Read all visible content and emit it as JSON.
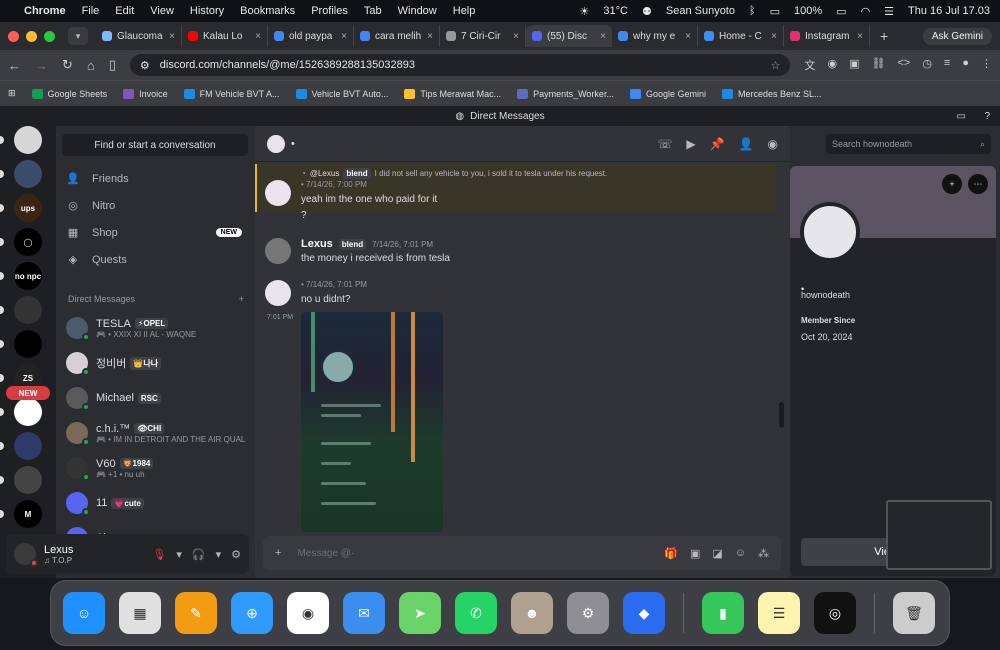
{
  "menubar": {
    "app": "Chrome",
    "items": [
      "File",
      "Edit",
      "View",
      "History",
      "Bookmarks",
      "Profiles",
      "Tab",
      "Window",
      "Help"
    ],
    "weather": "31°C",
    "user": "Sean Sunyoto",
    "battery": "100%",
    "datetime": "Thu 16 Jul  17.03"
  },
  "tabs": [
    {
      "title": "Glaucoma",
      "color": "#7cb9ff"
    },
    {
      "title": "Kalau Lo",
      "color": "#ff0000"
    },
    {
      "title": "old paypa",
      "color": "#4285f4"
    },
    {
      "title": "cara melih",
      "color": "#4285f4"
    },
    {
      "title": "7 Ciri-Cir",
      "color": "#999999"
    },
    {
      "title": "(55) Disc",
      "color": "#5865f2"
    },
    {
      "title": "why my e",
      "color": "#4285f4"
    },
    {
      "title": "Home - C",
      "color": "#3e8ef7"
    },
    {
      "title": "Instagram",
      "color": "#e1306c"
    }
  ],
  "ask_gemini": "Ask Gemini",
  "url": "discord.com/channels/@me/1526389288135032893",
  "bookmarks": [
    {
      "label": "Google Sheets",
      "color": "#0f9d58"
    },
    {
      "label": "Invoice",
      "color": "#7e57c2"
    },
    {
      "label": "FM Vehicle BVT A...",
      "color": "#1e88e5"
    },
    {
      "label": "Vehicle BVT Auto...",
      "color": "#1e88e5"
    },
    {
      "label": "Tips Merawat Mac...",
      "color": "#fbc02d"
    },
    {
      "label": "Payments_Worker...",
      "color": "#5c6bc0"
    },
    {
      "label": "Google Gemini",
      "color": "#4285f4"
    },
    {
      "label": "Mercedes Benz SL...",
      "color": "#1e88e5"
    }
  ],
  "window_title": "Direct Messages",
  "servers": [
    {
      "label": "",
      "color": "#d7d7d7"
    },
    {
      "label": "",
      "color": "#3a4c6a"
    },
    {
      "label": "ups",
      "color": "#3c2415"
    },
    {
      "label": "◯",
      "color": "#000000"
    },
    {
      "label": "no npc",
      "color": "#000000"
    },
    {
      "label": "",
      "color": "#333333"
    },
    {
      "label": "",
      "color": "#000000"
    },
    {
      "label": "ZS",
      "color": "#222222"
    },
    {
      "label": "",
      "color": "#ffffff"
    },
    {
      "label": "",
      "color": "#2d3a6a"
    },
    {
      "label": "",
      "color": "#444444"
    },
    {
      "label": "M",
      "color": "#000000"
    }
  ],
  "new_badge": "NEW",
  "dm": {
    "find_placeholder": "Find or start a conversation",
    "nav": [
      {
        "icon": "friends-icon",
        "label": "Friends",
        "glyph": "👤"
      },
      {
        "icon": "nitro-icon",
        "label": "Nitro",
        "glyph": "◎"
      },
      {
        "icon": "shop-icon",
        "label": "Shop",
        "glyph": "▦",
        "badge": "NEW"
      },
      {
        "icon": "quests-icon",
        "label": "Quests",
        "glyph": "◈"
      }
    ],
    "header": "Direct Messages",
    "items": [
      {
        "name": "TESLA",
        "tag": "⚡OPEL",
        "sub": "🎮 • XXIX XI II AL - WAQNE",
        "color": "#4b5b6b"
      },
      {
        "name": "정비버",
        "tag": "👑나나",
        "sub": "",
        "color": "#d8cfd4"
      },
      {
        "name": "Michael",
        "tag": "RSC",
        "sub": "",
        "color": "#5a5a5a"
      },
      {
        "name": "c.h.i.™",
        "tag": "👁CHI",
        "sub": "🎮 • IM IN DETROIT AND THE AIR QUALI...",
        "color": "#7a6a5a"
      },
      {
        "name": "V60",
        "tag": "🦁1984",
        "sub": "🎮 +1 • nu uh",
        "color": "#333333"
      },
      {
        "name": "11",
        "tag": "💗cute",
        "sub": "",
        "color": "#5865f2"
      },
      {
        "name": "Abo",
        "tag": "",
        "sub": "",
        "color": "#5865f2"
      }
    ]
  },
  "user": {
    "name": "Lexus",
    "status": "♫ T.O.P"
  },
  "chat": {
    "reply_user": "@Lexus",
    "reply_tag": "blend",
    "reply_text": "I did not sell any vehicle to you, i sold it to tesla under his request.",
    "messages": [
      {
        "time": "• 7/14/26, 7:00 PM",
        "text": "yeah im the one who paid for it",
        "text2": "?"
      },
      {
        "name": "Lexus",
        "tag": "blend",
        "time": "7/14/26, 7:01 PM",
        "text": "the money i received is from tesla"
      },
      {
        "time": "• 7/14/26, 7:01 PM",
        "text": "no u didnt?"
      }
    ],
    "side_time": "7:01 PM",
    "placeholder": "Message @·"
  },
  "profile": {
    "search_placeholder": "Search hownodeath",
    "display_name": "•",
    "username": "hownodeath",
    "member_since_label": "Member Since",
    "member_since": "Oct 20, 2024",
    "view_full": "View F"
  },
  "dock": [
    {
      "name": "finder-icon",
      "color": "#1e90ff",
      "glyph": "☺"
    },
    {
      "name": "launchpad-icon",
      "color": "#e0e0e0",
      "glyph": "▦"
    },
    {
      "name": "pages-icon",
      "color": "#f39c12",
      "glyph": "✎"
    },
    {
      "name": "safari-icon",
      "color": "#2f9bff",
      "glyph": "⊕"
    },
    {
      "name": "chrome-icon",
      "color": "#ffffff",
      "glyph": "◉"
    },
    {
      "name": "mail-icon",
      "color": "#3b8ef0",
      "glyph": "✉"
    },
    {
      "name": "maps-icon",
      "color": "#6ad36a",
      "glyph": "➤"
    },
    {
      "name": "whatsapp-icon",
      "color": "#25d366",
      "glyph": "✆"
    },
    {
      "name": "contacts-icon",
      "color": "#b0a090",
      "glyph": "☻"
    },
    {
      "name": "settings-icon",
      "color": "#8e8e93",
      "glyph": "⚙"
    },
    {
      "name": "roblox-icon",
      "color": "#2a6cf0",
      "glyph": "◆"
    },
    {
      "name": "numbers-icon",
      "color": "#34c759",
      "glyph": "▮"
    },
    {
      "name": "notes-icon",
      "color": "#fff3b0",
      "glyph": "☰"
    },
    {
      "name": "spotify-icon",
      "color": "#111111",
      "glyph": "◎"
    },
    {
      "name": "trash-icon",
      "color": "#cccccc",
      "glyph": "🗑"
    }
  ]
}
